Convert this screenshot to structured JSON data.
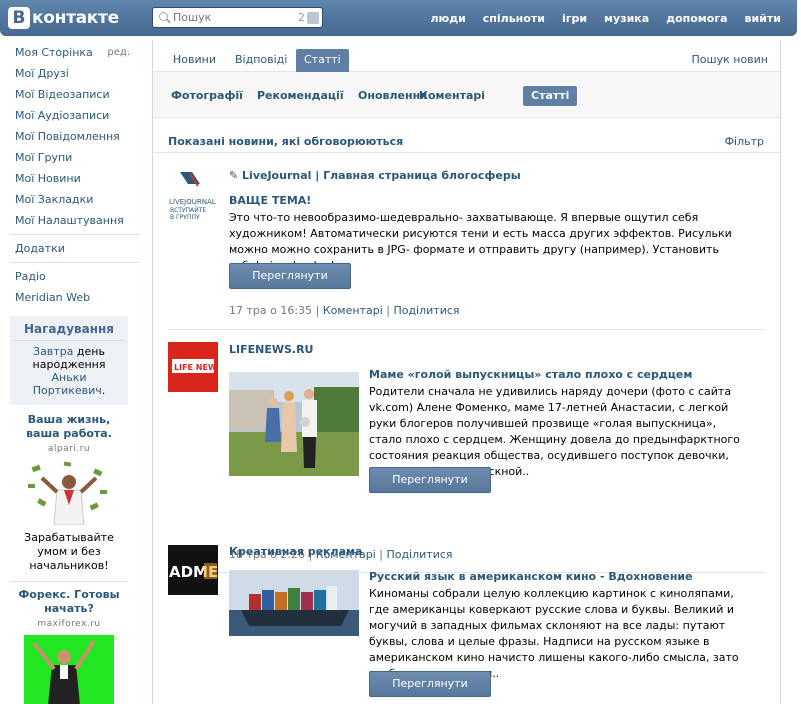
{
  "header": {
    "logo_letter": "В",
    "logo_text": "контакте",
    "search_placeholder": "Пошук",
    "search_count": "2",
    "nav": [
      "люди",
      "спільноти",
      "ігри",
      "музика",
      "допомога",
      "вийти"
    ]
  },
  "menu": {
    "my_page": "Моя Сторінка",
    "edit": "ред.",
    "items": [
      "Мої Друзі",
      "Мої Відеозаписи",
      "Мої Аудіозаписи",
      "Мої Повідомлення",
      "Мої Групи",
      "Мої Новини",
      "Мої Закладки",
      "Мої Налаштування"
    ],
    "apps": "Додатки",
    "extra": [
      "Радіо",
      "Meridian Web"
    ]
  },
  "reminder": {
    "title": "Нагадування",
    "when": "Завтра",
    "mid": " день народження ",
    "who": "Аньки Портикевич",
    "end": "."
  },
  "ads": [
    {
      "title": "Ваша жизнь, ваша работа.",
      "domain": "alpari.ru",
      "caption": "Зарабатывайте умом и без начальников!",
      "bg": "#ffffff"
    },
    {
      "title": "Форекс. Готовы начать?",
      "domain": "maxiforex.ru",
      "caption": "",
      "bg": "#22e622"
    }
  ],
  "tabs": {
    "top": [
      "Новини",
      "Відповіді",
      "Статті"
    ],
    "top_active": 2,
    "search_news": "Пошук новин",
    "sub": [
      "Фотографії",
      "Рекомендації",
      "Оновлення",
      "Коментарі",
      "Статті"
    ],
    "sub_active": 4
  },
  "feed": {
    "shown": "Показані новини, які обговорюються",
    "filter": "Фільтр"
  },
  "posts": [
    {
      "source": "✎ LiveJournal | Главная страница блогосферы",
      "logo_lines": [
        "LIVEJOURNAL",
        "ВСТУПАЙТЕ",
        "В ГРУППУ"
      ],
      "title": "ВАЩЕ ТЕМА!",
      "text": "Это что-то невообразимо-шедеврально- захватывающе. Я впервые ощутил себя художником! Автоматически рисуются тени и есть масса других эффектов. Рисульки можно можно сохранить в JPG- формате и отправить другу (например).  Установить себе! via zdravbyd",
      "button": "Переглянути",
      "time": "17 тра о 16:35",
      "comments": "Коментарі",
      "share": "Поділитися"
    },
    {
      "source": "LIFENEWS.RU",
      "logo_text": "LIFE NEWS",
      "title": "Маме «голой выпускницы» стало плохо с сердцем",
      "text": "Родители сначала не удивились наряду дочери (фото с сайта vk.com) Алене Фоменко, маме 17-летней Анастасии, с легкой руки блогеров получившей прозвище «голая выпускница», стало плохо с сердцем. Женщину довела до предынфарктного состояния реакция общества, осудившего поступок девочки, пришедшей на выпускной..",
      "button": "Переглянути",
      "time": "18 тра о 2:26",
      "comments": "Коментарі",
      "share": "Поділитися"
    },
    {
      "source": "Креативная реклама",
      "logo_text": "ADME",
      "title": "Русский язык в американском кино - Вдохновение",
      "text": "Киноманы собрали целую коллекцию картинок с киноляпами, где американцы коверкают русские слова и буквы. Великий и могучий в западных фильмах склоняют на все лады: путают буквы, слова и целые фразы. Надписи на русском языке в американском кино начисто лишены какого-либо смысла, зато изобилуют поводами..",
      "button": "Переглянути"
    }
  ]
}
